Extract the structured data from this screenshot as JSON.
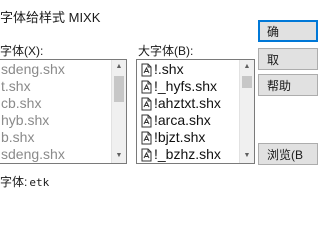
{
  "dialog": {
    "title": "字体给样式 MIXK"
  },
  "small_font": {
    "label": "字体(X):",
    "items": [
      "sdeng.shx",
      "t.shx",
      "cb.shx",
      "hyb.shx",
      "b.shx",
      "sdeng.shx"
    ]
  },
  "big_font": {
    "label": "大字体(B):",
    "items": [
      "!.shx",
      "!_hyfs.shx",
      "!ahztxt.shx",
      "!arca.shx",
      "!bjzt.shx",
      "!_bzhz.shx"
    ]
  },
  "buttons": {
    "ok": "确",
    "cancel": "取",
    "help": "帮助",
    "browse": "浏览(B"
  },
  "status": {
    "label": "字体:",
    "value": "etk"
  },
  "icons": {
    "font_file": "shx-font-file-icon",
    "scroll_up": "scroll-up-arrow-icon",
    "scroll_down": "scroll-down-arrow-icon"
  }
}
